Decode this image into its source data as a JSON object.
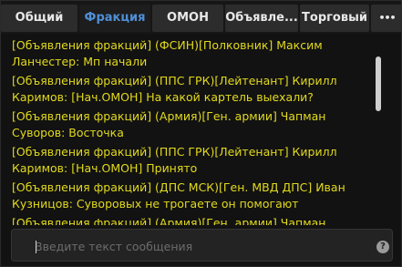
{
  "tabs": [
    {
      "label": "Общий",
      "active": false
    },
    {
      "label": "Фракция",
      "active": true
    },
    {
      "label": "ОМОН",
      "active": false
    },
    {
      "label": "Объявле...",
      "active": false
    },
    {
      "label": "Торговый",
      "active": false
    }
  ],
  "more_button_label": "•••",
  "messages": [
    {
      "line1": "[Объявления фракций] (ФСИН)[Полковник] Максим",
      "line2": "Ланчестер: Мп начали"
    },
    {
      "line1": "[Объявления фракций] (ППС ГРК)[Лейтенант] Кирилл",
      "line2": "Каримов: [Нач.ОМОН] На какой картель выехали?"
    },
    {
      "line1": "[Объявления фракций] (Армия)[Ген. армии] Чапман",
      "line2": "Суворов: Восточка"
    },
    {
      "line1": "[Объявления фракций] (ППС ГРК)[Лейтенант] Кирилл",
      "line2": "Каримов: [Нач.ОМОН] Принято"
    },
    {
      "line1": "[Объявления фракций] (ДПС МСК)[Ген. МВД ДПС] Иван",
      "line2": "Кузницов: Суворовых не трогаете он помогают"
    },
    {
      "line1": "[Объявления фракций] (Армия)[Ген. армии] Чапман",
      "line2": ""
    }
  ],
  "input": {
    "placeholder": "Введите текст сообщения",
    "value": ""
  },
  "help_icon_label": "?",
  "colors": {
    "message_text": "#e2da1e",
    "active_tab": "#4f8fd6"
  }
}
